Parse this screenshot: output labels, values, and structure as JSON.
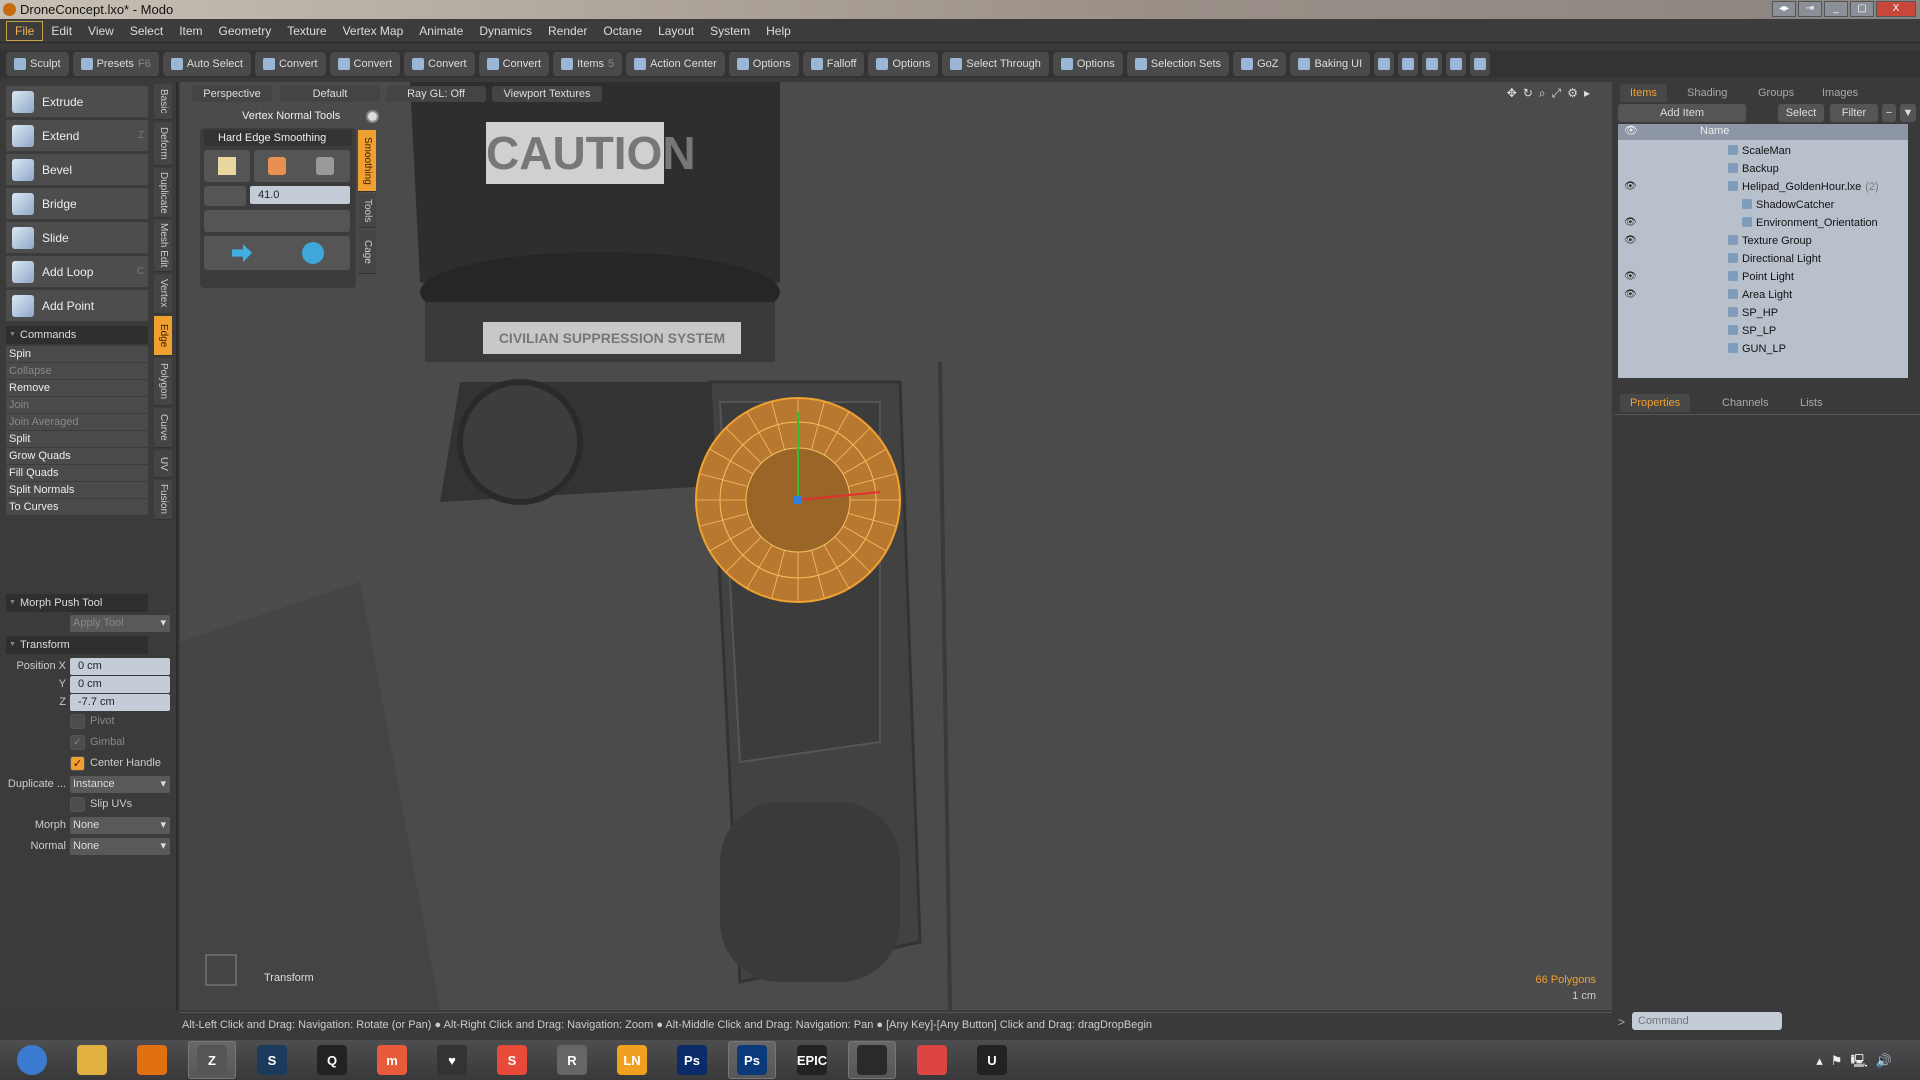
{
  "window": {
    "title": "DroneConcept.lxo* - Modo"
  },
  "menu": [
    "File",
    "Edit",
    "View",
    "Select",
    "Item",
    "Geometry",
    "Texture",
    "Vertex Map",
    "Animate",
    "Dynamics",
    "Render",
    "Octane",
    "Layout",
    "System",
    "Help"
  ],
  "toolbar": [
    {
      "label": "Sculpt",
      "icon": "brush-icon"
    },
    {
      "label": "Presets",
      "icon": "presets-icon",
      "key": "F6"
    },
    {
      "label": "Auto Select",
      "icon": "auto-select-icon"
    },
    {
      "label": "Convert",
      "icon": "vertex-convert-icon"
    },
    {
      "label": "Convert",
      "icon": "edge-convert-icon"
    },
    {
      "label": "Convert",
      "icon": "polygon-convert-icon"
    },
    {
      "label": "Convert",
      "icon": "item-convert-icon"
    },
    {
      "label": "Items",
      "icon": "items-icon",
      "key": "5"
    },
    {
      "label": "Action Center",
      "icon": "action-center-icon"
    },
    {
      "label": "Options",
      "icon": "options-icon"
    },
    {
      "label": "Falloff",
      "icon": "falloff-icon"
    },
    {
      "label": "Options",
      "icon": "options-icon"
    },
    {
      "label": "Select Through",
      "icon": "select-through-icon"
    },
    {
      "label": "Options",
      "icon": "options-icon"
    },
    {
      "label": "Selection Sets",
      "icon": "selection-sets-icon"
    },
    {
      "label": "GoZ",
      "icon": "goz-icon"
    },
    {
      "label": "Baking UI",
      "icon": "baking-icon"
    }
  ],
  "left": {
    "tools": [
      {
        "label": "Extrude"
      },
      {
        "label": "Extend",
        "key": "Z"
      },
      {
        "label": "Bevel"
      },
      {
        "label": "Bridge"
      },
      {
        "label": "Slide"
      },
      {
        "label": "Add Loop",
        "key": "C"
      },
      {
        "label": "Add Point"
      }
    ],
    "commands_header": "Commands",
    "commands": [
      {
        "label": "Spin",
        "enabled": true
      },
      {
        "label": "Collapse",
        "enabled": false
      },
      {
        "label": "Remove",
        "enabled": true
      },
      {
        "label": "Join",
        "enabled": false
      },
      {
        "label": "Join Averaged",
        "enabled": false
      },
      {
        "label": "Split",
        "enabled": true
      },
      {
        "label": "Grow Quads",
        "enabled": true
      },
      {
        "label": "Fill Quads",
        "enabled": true
      },
      {
        "label": "Split Normals",
        "enabled": true
      },
      {
        "label": "To Curves",
        "enabled": true
      }
    ],
    "vtabs": [
      "Basic",
      "Deform",
      "Duplicate",
      "Mesh Edit",
      "Vertex",
      "Edge",
      "Polygon",
      "Curve",
      "UV",
      "Fusion"
    ],
    "active_vtab": "Edge",
    "morph_header": "Morph Push Tool",
    "apply_tool": "Apply Tool",
    "transform_header": "Transform",
    "position_label": "Position X",
    "y_label": "Y",
    "z_label": "Z",
    "pos_x": "0 cm",
    "pos_y": "0 cm",
    "pos_z": "-7.7 cm",
    "pivot": "Pivot",
    "gimbal": "Gimbal",
    "center_handle": "Center Handle",
    "duplicate_label": "Duplicate ...",
    "duplicate_value": "Instance",
    "slip_uvs": "Slip UVs",
    "morph_label": "Morph",
    "morph_value": "None",
    "normal_label": "Normal",
    "normal_value": "None"
  },
  "viewport": {
    "header": [
      "Perspective",
      "Default",
      "Ray GL: Off",
      "Viewport Textures"
    ],
    "vnt_title": "Vertex Normal Tools",
    "hes_title": "Hard Edge Smoothing",
    "angle_value": "41.0",
    "vnt_tabs": [
      "Smoothing",
      "Tools",
      "Cage"
    ],
    "label_caution": "CAUTION",
    "label_system": "CIVILIAN SUPPRESSION SYSTEM",
    "tool_name": "Transform",
    "polygons": "66 Polygons",
    "scale": "1 cm",
    "accent": "#f0a030"
  },
  "status": "Alt-Left Click and Drag: Navigation: Rotate (or Pan) ● Alt-Right Click and Drag: Navigation: Zoom ● Alt-Middle Click and Drag: Navigation: Pan ● [Any Key]-[Any Button] Click and Drag: dragDropBegin",
  "right": {
    "tabs": [
      "Items",
      "Shading",
      "Groups",
      "Images"
    ],
    "add_item": "Add Item",
    "select": "Select",
    "filter": "Filter",
    "name_col": "Name",
    "items": [
      {
        "name": "ScaleMan",
        "visible": false,
        "depth": 0
      },
      {
        "name": "Backup",
        "visible": false,
        "depth": 0
      },
      {
        "name": "Helipad_GoldenHour.lxe",
        "count": "(2)",
        "visible": true,
        "depth": 0
      },
      {
        "name": "ShadowCatcher",
        "visible": false,
        "depth": 1
      },
      {
        "name": "Environment_Orientation",
        "visible": true,
        "depth": 1
      },
      {
        "name": "Texture Group",
        "visible": true,
        "depth": 0
      },
      {
        "name": "Directional Light",
        "visible": false,
        "depth": 0
      },
      {
        "name": "Point Light",
        "visible": true,
        "depth": 0
      },
      {
        "name": "Area Light",
        "visible": true,
        "depth": 0
      },
      {
        "name": "SP_HP",
        "visible": false,
        "depth": 0
      },
      {
        "name": "SP_LP",
        "visible": false,
        "depth": 0
      },
      {
        "name": "GUN_LP",
        "visible": false,
        "depth": 0
      }
    ],
    "prop_tabs": [
      "Properties",
      "Channels",
      "Lists"
    ],
    "command_placeholder": "Command"
  },
  "taskbar": [
    {
      "name": "start",
      "label": "",
      "color": "#3b7bd0"
    },
    {
      "name": "explorer",
      "label": "",
      "color": "#e0b040"
    },
    {
      "name": "modo",
      "label": "",
      "color": "#e07010"
    },
    {
      "name": "zbrush",
      "label": "Z",
      "color": "#555"
    },
    {
      "name": "steam",
      "label": "S",
      "color": "#1b3a5c"
    },
    {
      "name": "quixel",
      "label": "Q",
      "color": "#222"
    },
    {
      "name": "marmoset",
      "label": "m",
      "color": "#e85a3a"
    },
    {
      "name": "app-heart",
      "label": "♥",
      "color": "#333"
    },
    {
      "name": "substance",
      "label": "S",
      "color": "#e84a3a"
    },
    {
      "name": "app-r",
      "label": "R",
      "color": "#666"
    },
    {
      "name": "lightning",
      "label": "LN",
      "color": "#f0a020"
    },
    {
      "name": "photoshop",
      "label": "Ps",
      "color": "#0a2a6a"
    },
    {
      "name": "photoshop2",
      "label": "Ps",
      "color": "#0a3a7a"
    },
    {
      "name": "epic",
      "label": "EPIC",
      "color": "#222"
    },
    {
      "name": "app-dark",
      "label": "",
      "color": "#2a2a2a"
    },
    {
      "name": "chrome",
      "label": "",
      "color": "#d44"
    },
    {
      "name": "unreal",
      "label": "U",
      "color": "#222"
    }
  ]
}
